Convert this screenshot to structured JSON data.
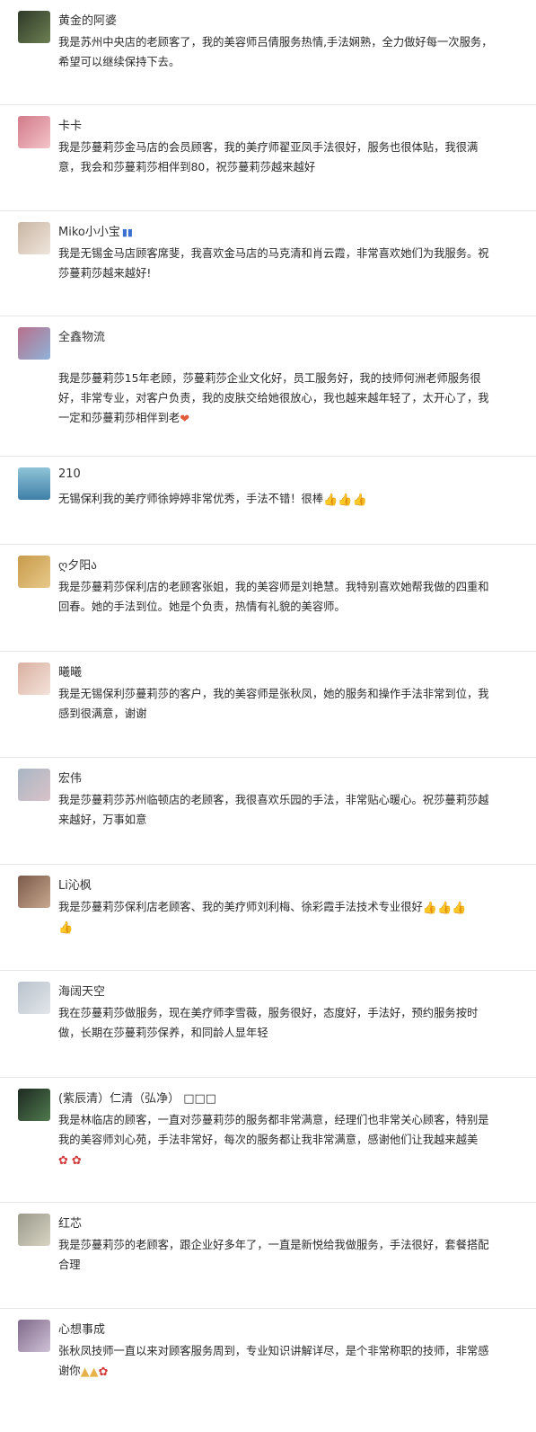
{
  "comments": [
    {
      "name": "黄金的阿婆",
      "avatar_colors": [
        "#2f3a28",
        "#6c7f52"
      ],
      "lines": [
        "我是苏州中央店的老顾客了，我的美容师吕倩服务热情,手法娴熟，全力做好每一次服务，",
        "希望可以继续保持下去。"
      ],
      "emojis": []
    },
    {
      "name": "卡卡",
      "avatar_colors": [
        "#d27a8a",
        "#f3c4c8"
      ],
      "lines": [
        "我是莎蔓莉莎金马店的会员顾客，我的美疗师翟亚凤手法很好，服务也很体贴，我很满",
        "意，我会和莎蔓莉莎相伴到80，祝莎蔓莉莎越来越好"
      ],
      "emojis": []
    },
    {
      "name": "Miko小小宝",
      "badge": "▮▮",
      "avatar_colors": [
        "#c9b6a4",
        "#efe5dc"
      ],
      "lines": [
        "我是无锡金马店顾客席斐，我喜欢金马店的马克清和肖云霞，非常喜欢她们为我服务。祝",
        "莎蔓莉莎越来越好!"
      ],
      "emojis": []
    },
    {
      "name": "全鑫物流",
      "avatar_colors": [
        "#b86f8a",
        "#8fb3d9"
      ],
      "lines": [
        "",
        "我是莎蔓莉莎15年老顾，莎蔓莉莎企业文化好，员工服务好，我的技师何洲老师服务很",
        "好，非常专业，对客户负责，我的皮肤交给她很放心，我也越来越年轻了，太开心了，我",
        "一定和莎蔓莉莎相伴到老"
      ],
      "emojis": [
        "heart"
      ]
    },
    {
      "name": "210",
      "avatar_colors": [
        "#3f7fa8",
        "#8fc4d8"
      ],
      "lines": [
        "无锡保利我的美疗师徐婷婷非常优秀，手法不错！很棒"
      ],
      "emojis": [
        "thumb",
        "thumb",
        "thumb"
      ]
    },
    {
      "name": "ღ夕阳ა",
      "avatar_colors": [
        "#c79a4a",
        "#e8c98a"
      ],
      "lines": [
        "我是莎蔓莉莎保利店的老顾客张姐，我的美容师是刘艳慧。我特别喜欢她帮我做的四重和",
        "回春。她的手法到位。她是个负责，热情有礼貌的美容师。"
      ],
      "emojis": []
    },
    {
      "name": "曦曦",
      "avatar_colors": [
        "#d9b0a0",
        "#f4e2da"
      ],
      "lines": [
        "我是无锡保利莎蔓莉莎的客户，我的美容师是张秋凤，她的服务和操作手法非常到位，我",
        "感到很满意，谢谢"
      ],
      "emojis": []
    },
    {
      "name": "宏伟",
      "avatar_colors": [
        "#a8b6c4",
        "#d9c2c8"
      ],
      "lines": [
        "我是莎蔓莉莎苏州临顿店的老顾客，我很喜欢乐园的手法，非常贴心暖心。祝莎蔓莉莎越",
        "来越好，万事如意"
      ],
      "emojis": []
    },
    {
      "name": "Li沁枫",
      "avatar_colors": [
        "#7a5a4a",
        "#c9a88f"
      ],
      "lines": [
        "我是莎蔓莉莎保利店老顾客、我的美疗师刘利梅、徐彩霞手法技术专业很好",
        ""
      ],
      "emojis": [
        "thumb",
        "thumb",
        "thumb",
        "thumb"
      ]
    },
    {
      "name": "海阔天空",
      "avatar_colors": [
        "#b9c2cc",
        "#e2e6ea"
      ],
      "lines": [
        "我在莎蔓莉莎做服务，现在美疗师李雪薇，服务很好，态度好，手法好，预约服务按时",
        "做，长期在莎蔓莉莎保养，和同龄人显年轻"
      ],
      "emojis": []
    },
    {
      "name": "(紫辰清）仁清（弘净）",
      "badge": "□□□",
      "avatar_colors": [
        "#1e2a22",
        "#4f7a4e"
      ],
      "lines": [
        "我是林临店的顾客，一直对莎蔓莉莎的服务都非常满意，经理们也非常关心顾客，特别是",
        "我的美容师刘心苑，手法非常好，每次的服务都让我非常满意，感谢他们让我越来越美",
        ""
      ],
      "emojis": [
        "rose",
        "rose"
      ]
    },
    {
      "name": "红芯",
      "avatar_colors": [
        "#9a9a8a",
        "#d8d4c4"
      ],
      "lines": [
        "我是莎蔓莉莎的老顾客，跟企业好多年了，一直是新悦给我做服务，手法很好，套餐搭配",
        "合理"
      ],
      "emojis": []
    },
    {
      "name": "心想事成",
      "avatar_colors": [
        "#7f6a8a",
        "#cfc0d6"
      ],
      "lines": [
        "张秋凤技师一直以来对顾客服务周到，专业知识讲解详尽，是个非常称职的技师，非常感",
        "谢你"
      ],
      "emojis": [
        "hands",
        "hands",
        "rose"
      ]
    }
  ]
}
